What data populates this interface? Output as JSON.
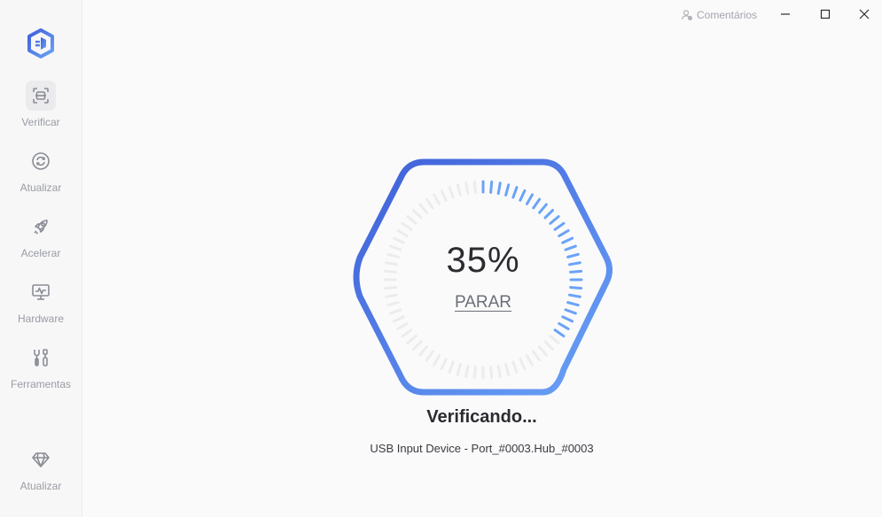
{
  "sidebar": {
    "logo_icon": "driver-logo-icon",
    "items": [
      {
        "label": "Verificar",
        "icon": "scan-icon",
        "active": true
      },
      {
        "label": "Atualizar",
        "icon": "refresh-icon",
        "active": false
      },
      {
        "label": "Acelerar",
        "icon": "rocket-icon",
        "active": false
      },
      {
        "label": "Hardware",
        "icon": "monitor-icon",
        "active": false
      },
      {
        "label": "Ferramentas",
        "icon": "tools-icon",
        "active": false
      }
    ],
    "bottom_items": [
      {
        "label": "Atualizar",
        "icon": "diamond-icon"
      }
    ]
  },
  "titlebar": {
    "feedback_label": "Comentários",
    "feedback_icon": "user-feedback-icon",
    "minimize_icon": "minimize-icon",
    "maximize_icon": "maximize-icon",
    "close_icon": "close-icon"
  },
  "scan": {
    "progress": 35,
    "percent_text": "35%",
    "stop_label": "PARAR",
    "status_title": "Verificando...",
    "device": "USB Input Device - Port_#0003.Hub_#0003"
  },
  "colors": {
    "accent_start": "#3f5fd8",
    "accent_end": "#6aa3f7",
    "track": "#ececee",
    "sidebar_bg": "#f7f7f8"
  }
}
